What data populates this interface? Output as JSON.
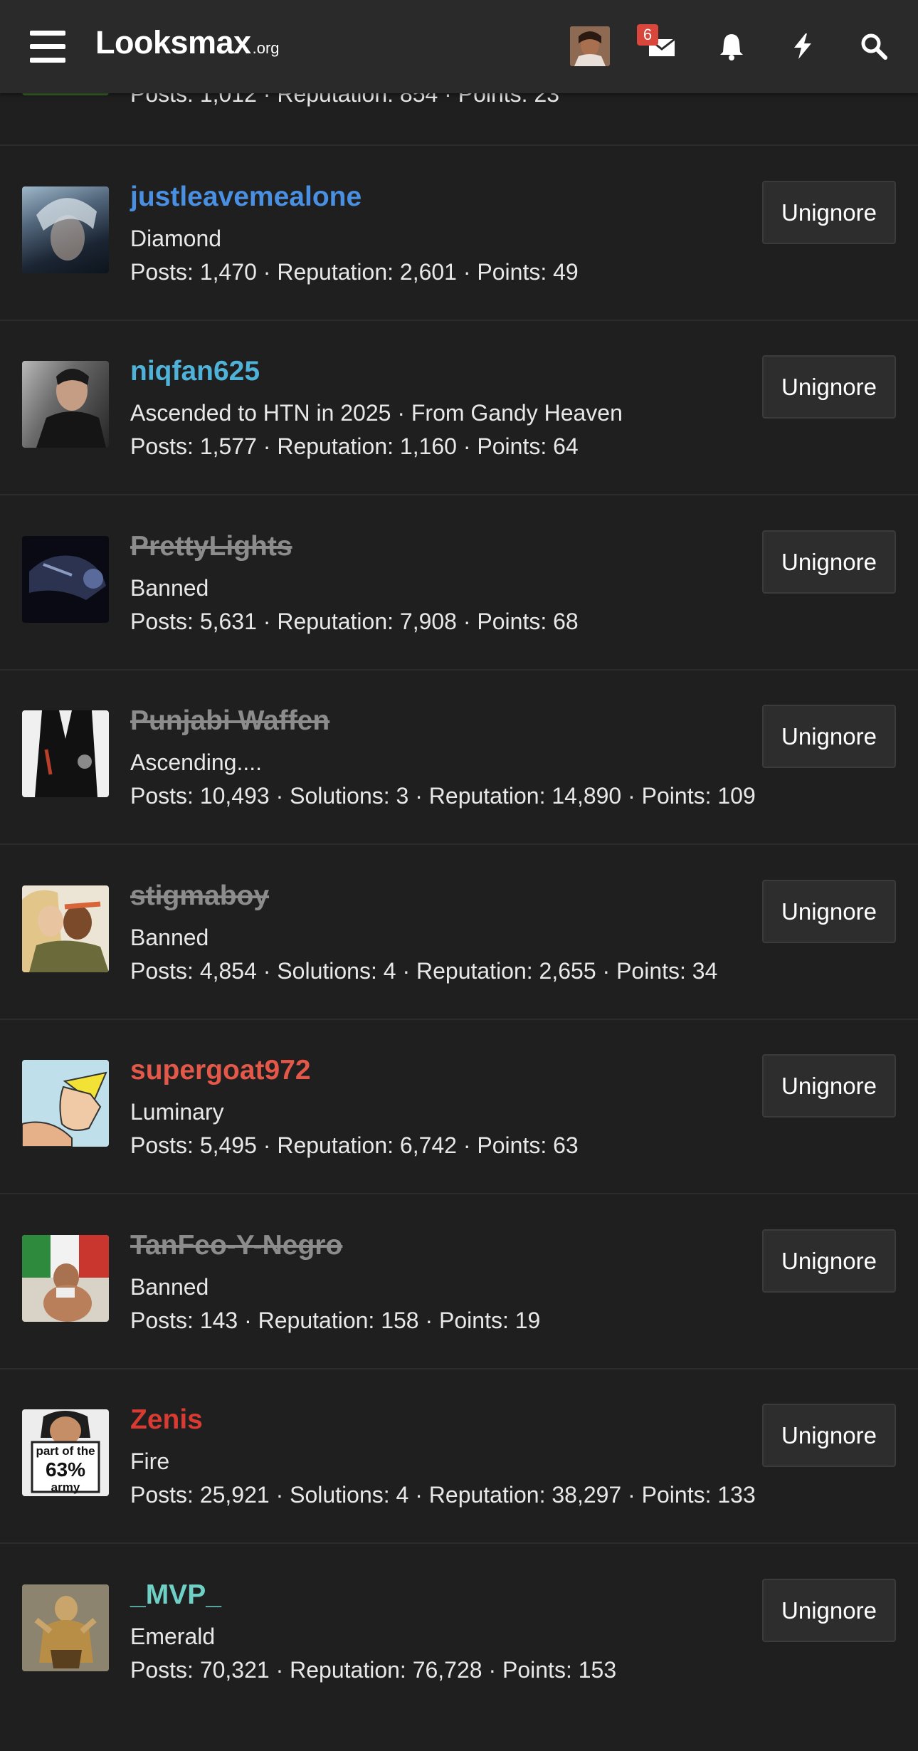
{
  "header": {
    "logo": "Lᴏᴏksmax",
    "logo_suffix": ".org",
    "inbox_badge": "6",
    "icons": [
      "menu-icon",
      "mail-icon",
      "bell-icon",
      "lightning-icon",
      "search-icon"
    ]
  },
  "partial_row": {
    "stats": "Posts: 1,012 · Reputation: 854 · Points: 23"
  },
  "users": [
    {
      "name": "justleavemealone",
      "title": "Diamond",
      "stats": "Posts: 1,470 · Reputation: 2,601 · Points: 49",
      "name_color": "#4a90e2",
      "banned": false,
      "button": "Unignore"
    },
    {
      "name": "niqfan625",
      "title": "Ascended to HTN in 2025 · From Gandy Heaven",
      "stats": "Posts: 1,577 · Reputation: 1,160 · Points: 64",
      "name_color": "#4fb3d9",
      "banned": false,
      "button": "Unignore"
    },
    {
      "name": "PrettyLights",
      "title": "Banned",
      "stats": "Posts: 5,631 · Reputation: 7,908 · Points: 68",
      "name_color": "#8c8c8c",
      "banned": true,
      "button": "Unignore"
    },
    {
      "name": "Punjabi Waffen",
      "title": "Ascending....",
      "stats": "Posts: 10,493 · Solutions: 3 · Reputation: 14,890 · Points: 109",
      "name_color": "#8c8c8c",
      "banned": true,
      "button": "Unignore"
    },
    {
      "name": "stigmaboy",
      "title": "Banned",
      "stats": "Posts: 4,854 · Solutions: 4 · Reputation: 2,655 · Points: 34",
      "name_color": "#8c8c8c",
      "banned": true,
      "button": "Unignore"
    },
    {
      "name": "supergoat972",
      "title": "Luminary",
      "stats": "Posts: 5,495 · Reputation: 6,742 · Points: 63",
      "name_color": "#e4584a",
      "banned": false,
      "button": "Unignore"
    },
    {
      "name": "TanFeo-Y-Negro",
      "title": "Banned",
      "stats": "Posts: 143 · Reputation: 158 · Points: 19",
      "name_color": "#8c8c8c",
      "banned": true,
      "button": "Unignore"
    },
    {
      "name": "Zenis",
      "title": "Fire",
      "stats": "Posts: 25,921 · Solutions: 4 · Reputation: 38,297 · Points: 133",
      "name_color": "#d93a32",
      "banned": false,
      "button": "Unignore"
    },
    {
      "name": "_MVP_",
      "title": "Emerald",
      "stats": "Posts: 70,321 · Reputation: 76,728 · Points: 153",
      "name_color": "#6fd0c6",
      "banned": false,
      "button": "Unignore"
    }
  ],
  "avatar_texts": {
    "zenis_sign_line1": "part of the",
    "zenis_sign_line2": "63%",
    "zenis_sign_line3": "army"
  }
}
